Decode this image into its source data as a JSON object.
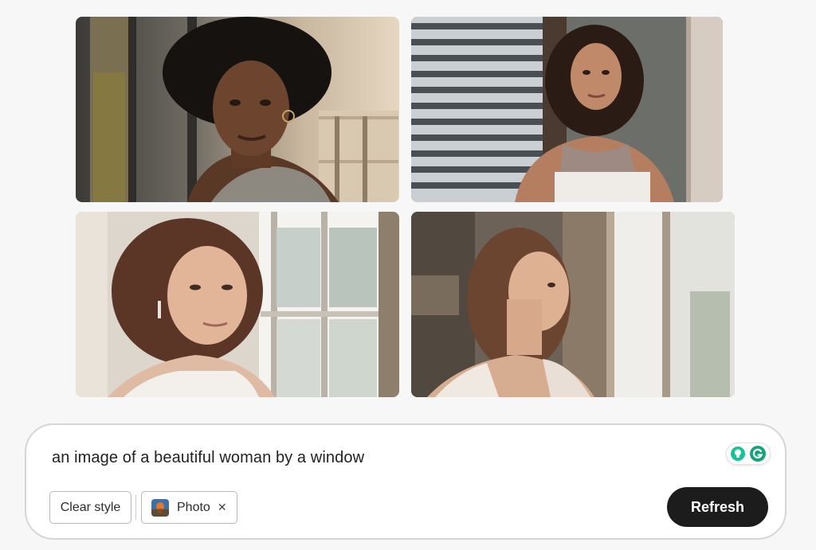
{
  "gallery": {
    "images": [
      {
        "name": "woman-window-1"
      },
      {
        "name": "woman-window-2"
      },
      {
        "name": "woman-window-3"
      },
      {
        "name": "woman-window-4"
      }
    ]
  },
  "prompt": {
    "text": "an image of a beautiful woman by a window",
    "assist_icons": [
      "lightbulb-icon",
      "grammarly-icon"
    ],
    "assist_colors": {
      "bulb": "#15c39a",
      "grammarly": "#15a37a"
    }
  },
  "style_chips": {
    "clear_label": "Clear style",
    "photo_label": "Photo",
    "photo_thumb_icon": "photo-style-thumbnail",
    "remove_icon": "close-icon",
    "remove_glyph": "✕"
  },
  "actions": {
    "refresh_label": "Refresh",
    "refresh_color": "#1c1c1c"
  }
}
